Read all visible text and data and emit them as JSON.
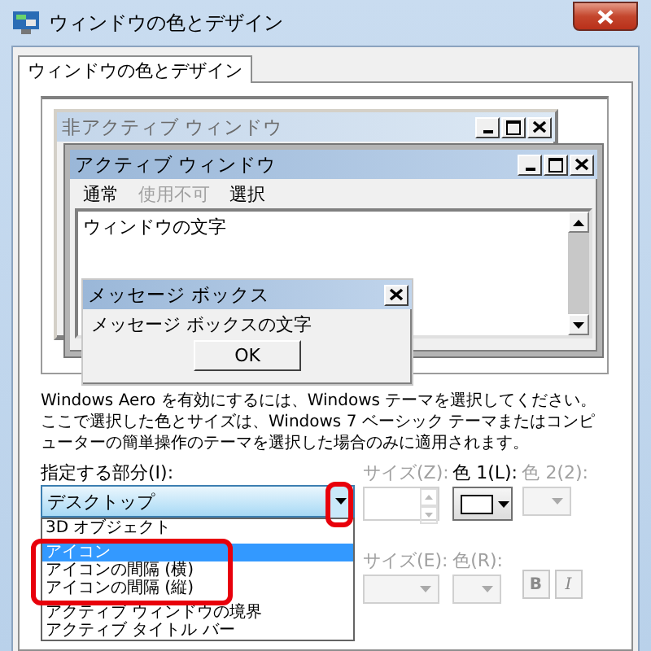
{
  "window": {
    "title": "ウィンドウの色とデザイン"
  },
  "tabs": [
    {
      "label": "ウィンドウの色とデザイン",
      "selected": true
    }
  ],
  "preview": {
    "inactive_window": {
      "title": "非アクティブ ウィンドウ"
    },
    "active_window": {
      "title": "アクティブ ウィンドウ",
      "menu": [
        {
          "label": "通常",
          "disabled": false
        },
        {
          "label": "使用不可",
          "disabled": true
        },
        {
          "label": "選択",
          "disabled": false
        }
      ],
      "text": "ウィンドウの文字"
    },
    "message_box": {
      "title": "メッセージ ボックス",
      "text": "メッセージ ボックスの文字",
      "button": "OK"
    }
  },
  "description": "Windows Aero を有効にするには、Windows テーマを選択してください。ここで選択した色とサイズは、Windows 7 ベーシック テーマまたはコンピューターの簡単操作のテーマを選択した場合のみに適用されます。",
  "item": {
    "label": "指定する部分(I):",
    "value": "デスクトップ",
    "expanded": true,
    "options": [
      {
        "label": "3D オブジェクト",
        "selected": false
      },
      {
        "label": "アイコン",
        "selected": true
      },
      {
        "label": "アイコンの間隔 (横)",
        "selected": false
      },
      {
        "label": "アイコンの間隔 (縦)",
        "selected": false
      },
      {
        "label": "アクティブ ウィンドウの境界",
        "selected": false
      },
      {
        "label": "アクティブ タイトル バー",
        "selected": false
      }
    ]
  },
  "size": {
    "label": "サイズ(Z):",
    "disabled": true
  },
  "color1": {
    "label": "色 1(L):",
    "disabled": false
  },
  "color2": {
    "label": "色 2(2):",
    "disabled": true
  },
  "font_size": {
    "label": "サイズ(E):",
    "disabled": true
  },
  "font_color": {
    "label": "色(R):",
    "disabled": true
  },
  "bold": {
    "label": "B",
    "disabled": true
  },
  "italic": {
    "label": "I",
    "disabled": true
  }
}
